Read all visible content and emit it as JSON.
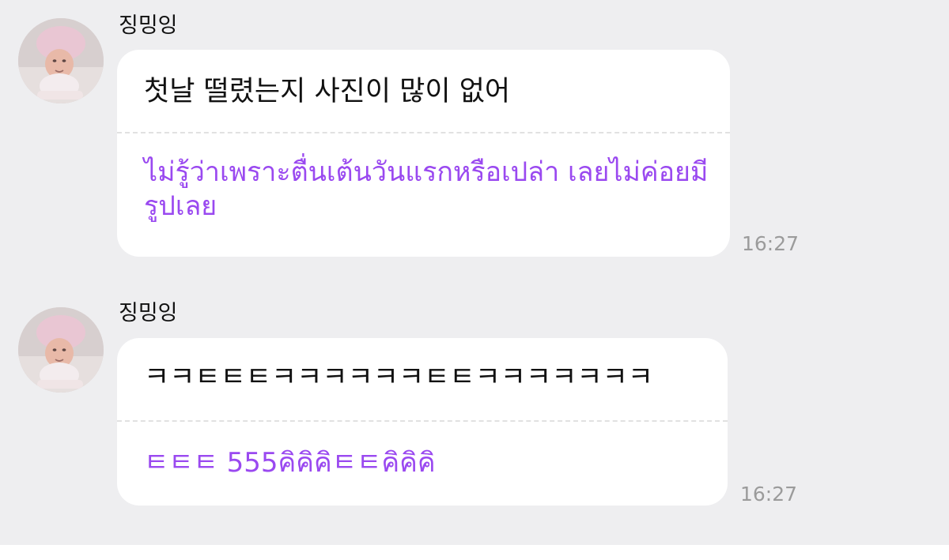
{
  "messages": [
    {
      "sender": "징밍잉",
      "original": "첫날 떨렸는지 사진이 많이 없어",
      "translation": "ไม่รู้ว่าเพราะตื่นเต้นวันแรกหรือเปล่า เลยไม่ค่อยมีรูปเลย",
      "time": "16:27"
    },
    {
      "sender": "징밍잉",
      "original": "ㅋㅋㅌㅌㅌㅋㅋㅋㅋㅋㅋㅌㅌㅋㅋㅋㅋㅋㅋㅋ",
      "translation": "ㅌㅌㅌ 555คิคิคิㅌㅌคิคิคิ",
      "time": "16:27"
    }
  ],
  "icons": {
    "avatar": "baby-photo-avatar"
  },
  "colors": {
    "background": "#eeeef0",
    "bubble": "#ffffff",
    "translation_text": "#9a49f0",
    "timestamp": "#9b9b9b"
  }
}
